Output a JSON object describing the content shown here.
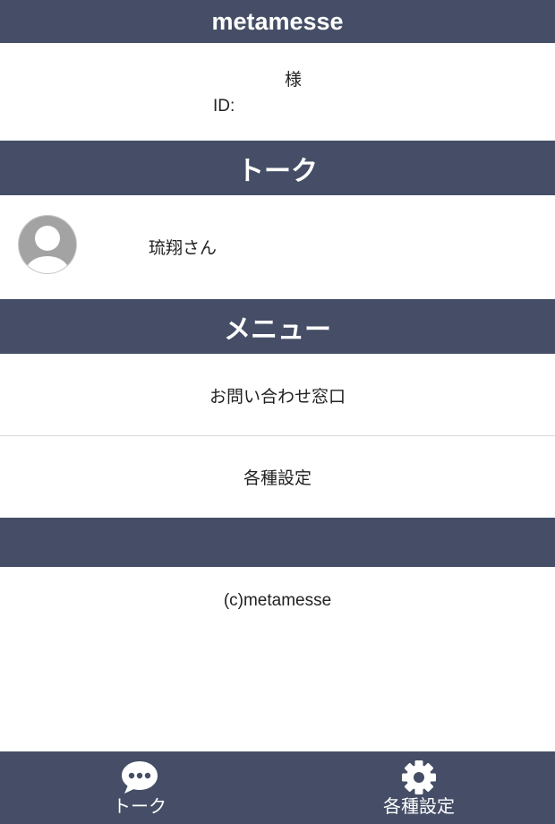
{
  "header": {
    "title": "metamesse"
  },
  "user": {
    "honorific": "様",
    "id_label": "ID:"
  },
  "talk": {
    "heading": "トーク",
    "items": [
      {
        "name": "琉翔さん",
        "avatar_icon": "default-avatar-icon"
      }
    ]
  },
  "menu": {
    "heading": "メニュー",
    "items": [
      {
        "label": "お問い合わせ窓口"
      },
      {
        "label": "各種設定"
      }
    ]
  },
  "footer": {
    "copyright": "(c)metamesse"
  },
  "bottom_nav": {
    "items": [
      {
        "label": "トーク",
        "icon": "chat-bubble-icon"
      },
      {
        "label": "各種設定",
        "icon": "gear-icon"
      }
    ]
  },
  "colors": {
    "bar": "#454e66",
    "bar_text": "#ffffff",
    "background": "#ffffff"
  }
}
